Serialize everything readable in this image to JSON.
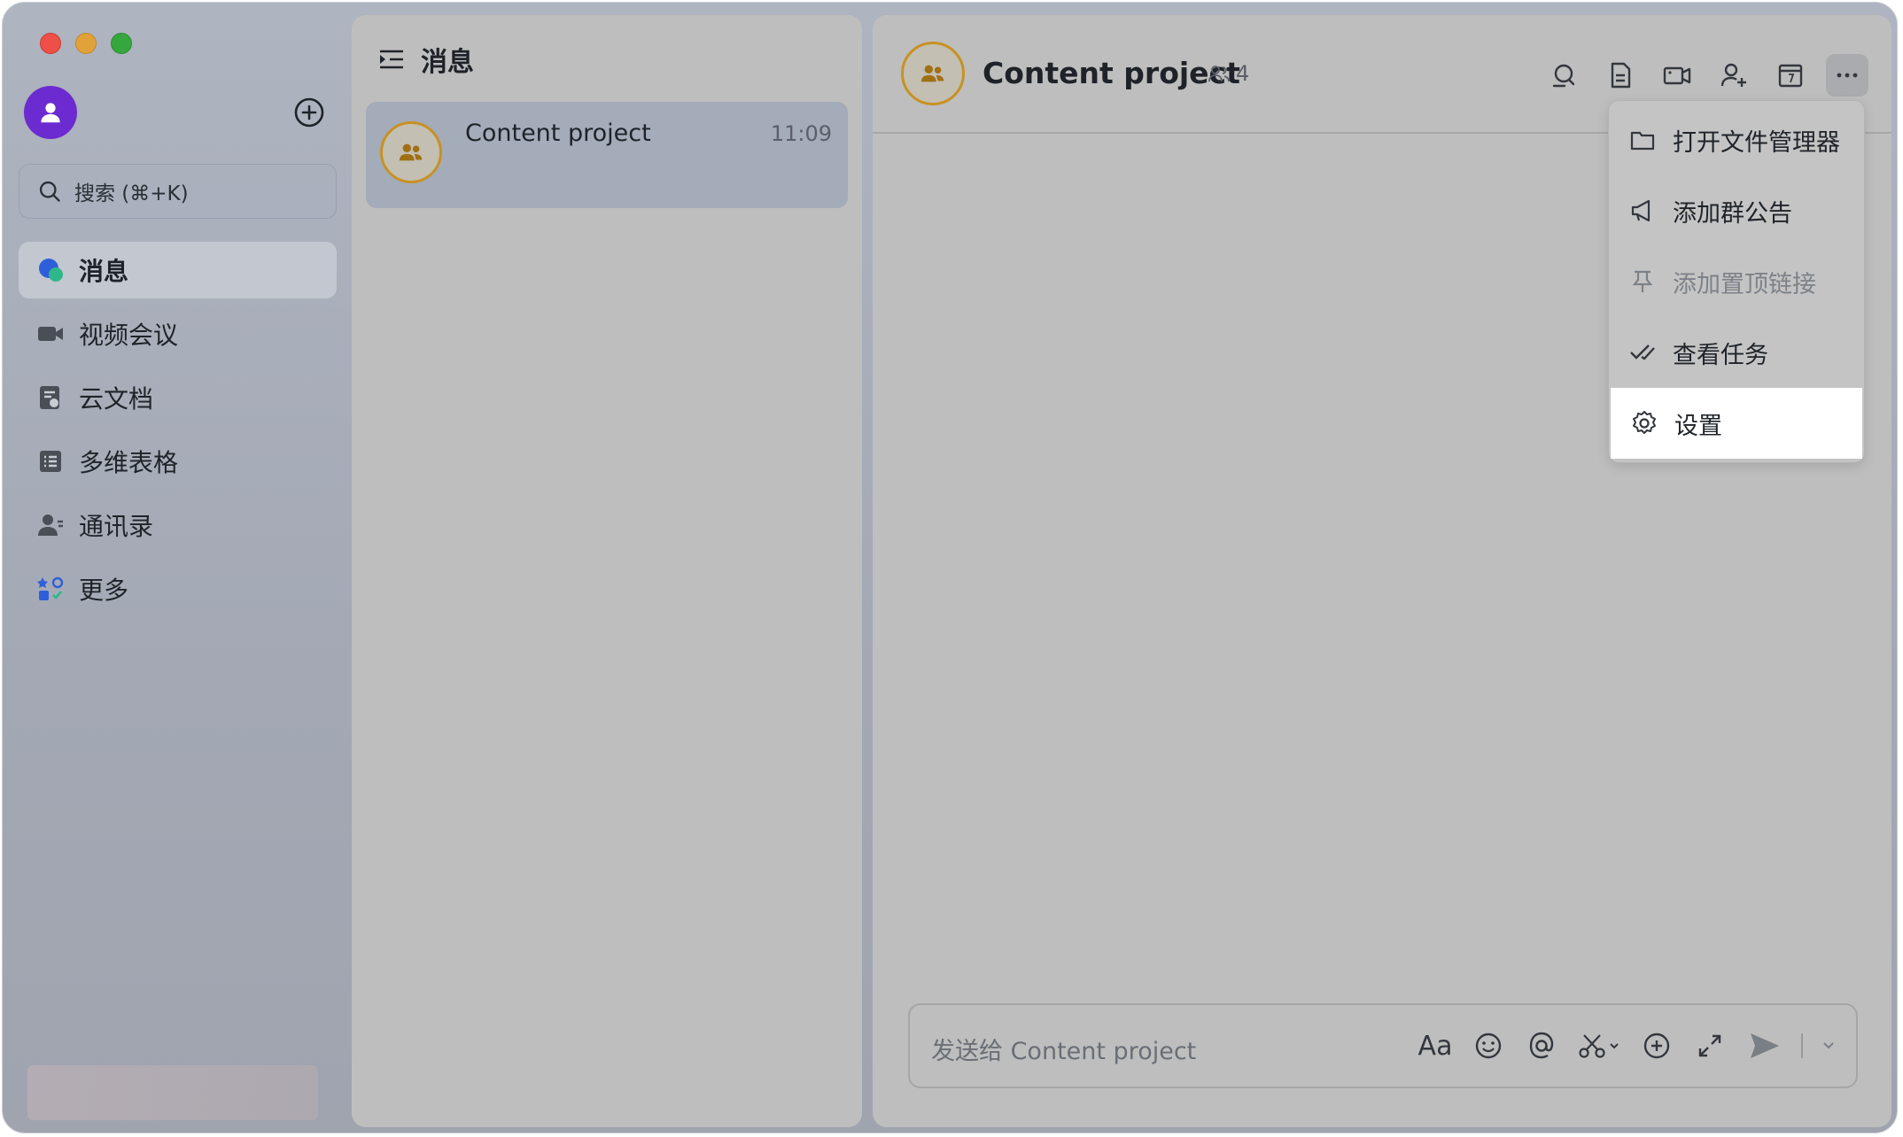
{
  "sidebar": {
    "search_placeholder": "搜索 (⌘+K)",
    "nav_items": [
      {
        "label": "消息",
        "icon": "chat-bubble-icon"
      },
      {
        "label": "视频会议",
        "icon": "video-camera-icon"
      },
      {
        "label": "云文档",
        "icon": "cloud-doc-icon"
      },
      {
        "label": "多维表格",
        "icon": "table-icon"
      },
      {
        "label": "通讯录",
        "icon": "contacts-icon"
      },
      {
        "label": "更多",
        "icon": "apps-icon"
      }
    ]
  },
  "list": {
    "title": "消息",
    "chats": [
      {
        "name": "Content project",
        "time": "11:09"
      }
    ]
  },
  "chat": {
    "title": "Content project",
    "member_count": "4",
    "input_placeholder": "发送给 Content project",
    "format_label": "Aa"
  },
  "menu": {
    "items": [
      {
        "label": "打开文件管理器",
        "icon": "folder-icon"
      },
      {
        "label": "添加群公告",
        "icon": "megaphone-icon"
      },
      {
        "label": "添加置顶链接",
        "icon": "pin-icon",
        "disabled": true
      },
      {
        "label": "查看任务",
        "icon": "task-check-icon"
      },
      {
        "label": "设置",
        "icon": "gear-icon"
      }
    ]
  },
  "colors": {
    "accent_purple": "#6c2bd0",
    "group_avatar_ring": "#c79224",
    "traffic_red": "#ee4f47",
    "traffic_yellow": "#e1a23a",
    "traffic_green": "#36a73f"
  }
}
